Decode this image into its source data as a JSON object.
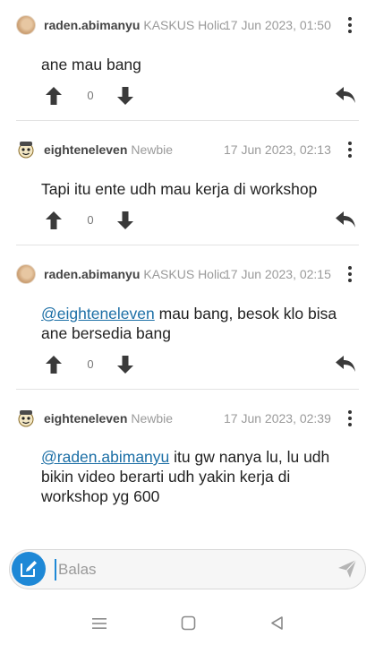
{
  "comments": [
    {
      "username": "raden.abimanyu",
      "rank": "KASKUS Holic",
      "timestamp": "17 Jun 2023, 01:50",
      "mention": "",
      "text": "ane mau bang",
      "votes": "0",
      "avatar": "avatar-raden"
    },
    {
      "username": "eighteneleven",
      "rank": "Newbie",
      "timestamp": "17 Jun 2023, 02:13",
      "mention": "",
      "text": "Tapi itu ente udh mau kerja di workshop",
      "votes": "0",
      "avatar": "avatar-eighteneleven"
    },
    {
      "username": "raden.abimanyu",
      "rank": "KASKUS Holic",
      "timestamp": "17 Jun 2023, 02:15",
      "mention": "@eighteneleven",
      "text": " mau bang, besok klo bisa ane bersedia bang",
      "votes": "0",
      "avatar": "avatar-raden"
    },
    {
      "username": "eighteneleven",
      "rank": "Newbie",
      "timestamp": "17 Jun 2023, 02:39",
      "mention": "@raden.abimanyu",
      "text": " itu gw nanya lu, lu udh bikin video berarti udh yakin kerja di workshop yg 600",
      "avatar": "avatar-eighteneleven"
    }
  ],
  "composer": {
    "placeholder": "Balas",
    "compose_icon": "edit-icon",
    "send_icon": "send-icon"
  },
  "icons": {
    "upvote": "arrow-up-icon",
    "downvote": "arrow-down-icon",
    "reply": "reply-icon",
    "more": "more-vertical-icon"
  },
  "system_nav": [
    "menu-icon",
    "home-icon",
    "back-icon"
  ],
  "colors": {
    "accent": "#1e88d6",
    "mention": "#1c6fa6",
    "muted_text": "#9a9a9a"
  }
}
